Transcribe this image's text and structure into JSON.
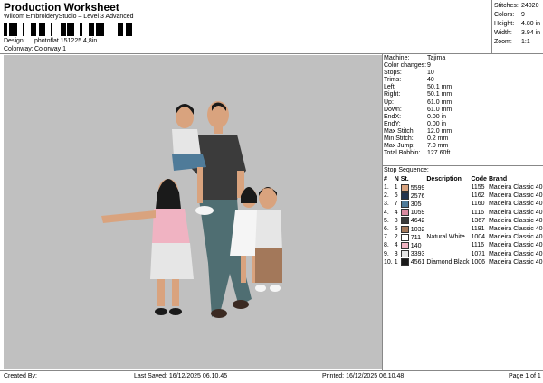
{
  "header": {
    "title": "Production Worksheet",
    "subtitle": "Wilcom EmbroideryStudio – Level 3 Advanced",
    "design_label": "Design:",
    "design_value": "photoflat 151225 4,8in",
    "colorway_label": "Colonway:",
    "colorway_value": "Colorway 1"
  },
  "stats": [
    {
      "label": "Stitches:",
      "value": "24020"
    },
    {
      "label": "Colors:",
      "value": "9"
    },
    {
      "label": "Height:",
      "value": "4.80 in"
    },
    {
      "label": "Width:",
      "value": "3.94 in"
    },
    {
      "label": "Zoom:",
      "value": "1:1"
    }
  ],
  "specs": [
    {
      "label": "Machine:",
      "value": "Tajima"
    },
    {
      "label": "Color changes:",
      "value": "9"
    },
    {
      "label": "Stops:",
      "value": "10"
    },
    {
      "label": "Trims:",
      "value": "40"
    },
    {
      "label": "Left:",
      "value": "50.1 mm"
    },
    {
      "label": "Right:",
      "value": "50.1 mm"
    },
    {
      "label": "Up:",
      "value": "61.0 mm"
    },
    {
      "label": "Down:",
      "value": "61.0 mm"
    },
    {
      "label": "EndX:",
      "value": "0.00 in"
    },
    {
      "label": "EndY:",
      "value": "0.00 in"
    },
    {
      "label": "Max Stitch:",
      "value": "12.0 mm"
    },
    {
      "label": "Min Stitch:",
      "value": "0.2 mm"
    },
    {
      "label": "Max Jump:",
      "value": "7.0 mm"
    },
    {
      "label": "Total Bobbin:",
      "value": "127.60ft"
    }
  ],
  "stop_sequence": {
    "heading": "Stop Sequence:",
    "columns": [
      "#",
      "N",
      "St.",
      "Description",
      "Code",
      "Brand"
    ],
    "rows": [
      {
        "num": "1.",
        "n": "1",
        "color": "#d9a37e",
        "st": "5599",
        "desc": "",
        "code": "1155",
        "brand": "Madeira Classic 40"
      },
      {
        "num": "2.",
        "n": "6",
        "color": "#23344e",
        "st": "2576",
        "desc": "",
        "code": "1162",
        "brand": "Madeira Classic 40"
      },
      {
        "num": "3.",
        "n": "7",
        "color": "#4f7b99",
        "st": "305",
        "desc": "",
        "code": "1160",
        "brand": "Madeira Classic 40"
      },
      {
        "num": "4.",
        "n": "4",
        "color": "#d98aa0",
        "st": "1059",
        "desc": "",
        "code": "1116",
        "brand": "Madeira Classic 40"
      },
      {
        "num": "5.",
        "n": "8",
        "color": "#3b3b3b",
        "st": "4642",
        "desc": "",
        "code": "1367",
        "brand": "Madeira Classic 40"
      },
      {
        "num": "6.",
        "n": "5",
        "color": "#a3785a",
        "st": "1032",
        "desc": "",
        "code": "1191",
        "brand": "Madeira Classic 40"
      },
      {
        "num": "7.",
        "n": "2",
        "color": "#ffffff",
        "st": "711",
        "desc": "Natural White",
        "code": "1004",
        "brand": "Madeira Classic 40"
      },
      {
        "num": "8.",
        "n": "4",
        "color": "#f0b3c2",
        "st": "140",
        "desc": "",
        "code": "1116",
        "brand": "Madeira Classic 40"
      },
      {
        "num": "9.",
        "n": "3",
        "color": "#e6e6e6",
        "st": "3393",
        "desc": "",
        "code": "1071",
        "brand": "Madeira Classic 40"
      },
      {
        "num": "10.",
        "n": "1",
        "color": "#1a1a1a",
        "st": "4561",
        "desc": "Diamond Black",
        "code": "1006",
        "brand": "Madeira Classic 40"
      }
    ]
  },
  "footer": {
    "created_by": "Created By:",
    "last_saved": "Last Saved: 16/12/2025 06.10.45",
    "printed": "Printed: 16/12/2025 06.10.48",
    "page": "Page 1 of 1"
  }
}
